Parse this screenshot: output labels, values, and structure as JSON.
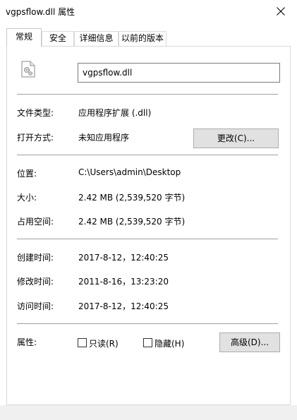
{
  "window": {
    "title": "vgpsflow.dll 属性",
    "close_icon": "close-icon"
  },
  "tabs": [
    {
      "label": "常规",
      "active": true
    },
    {
      "label": "安全"
    },
    {
      "label": "详细信息"
    },
    {
      "label": "以前的版本"
    }
  ],
  "general": {
    "file_icon": "dll-file-icon",
    "file_name": "vgpsflow.dll",
    "type_label": "文件类型:",
    "type_value": "应用程序扩展 (.dll)",
    "opens_label": "打开方式:",
    "opens_value": "未知应用程序",
    "change_button": "更改(C)...",
    "location_label": "位置:",
    "location_value": "C:\\Users\\admin\\Desktop",
    "size_label": "大小:",
    "size_value": "2.42 MB (2,539,520 字节)",
    "disk_label": "占用空间:",
    "disk_value": "2.42 MB (2,539,520 字节)",
    "created_label": "创建时间:",
    "created_value": "2017-8-12，12:40:25",
    "modified_label": "修改时间:",
    "modified_value": "2011-8-16，13:23:20",
    "accessed_label": "访问时间:",
    "accessed_value": "2017-8-12，12:40:25",
    "attributes_label": "属性:",
    "readonly_label": "只读(R)",
    "readonly_checked": false,
    "hidden_label": "隐藏(H)",
    "hidden_checked": false,
    "advanced_button": "高级(D)..."
  }
}
